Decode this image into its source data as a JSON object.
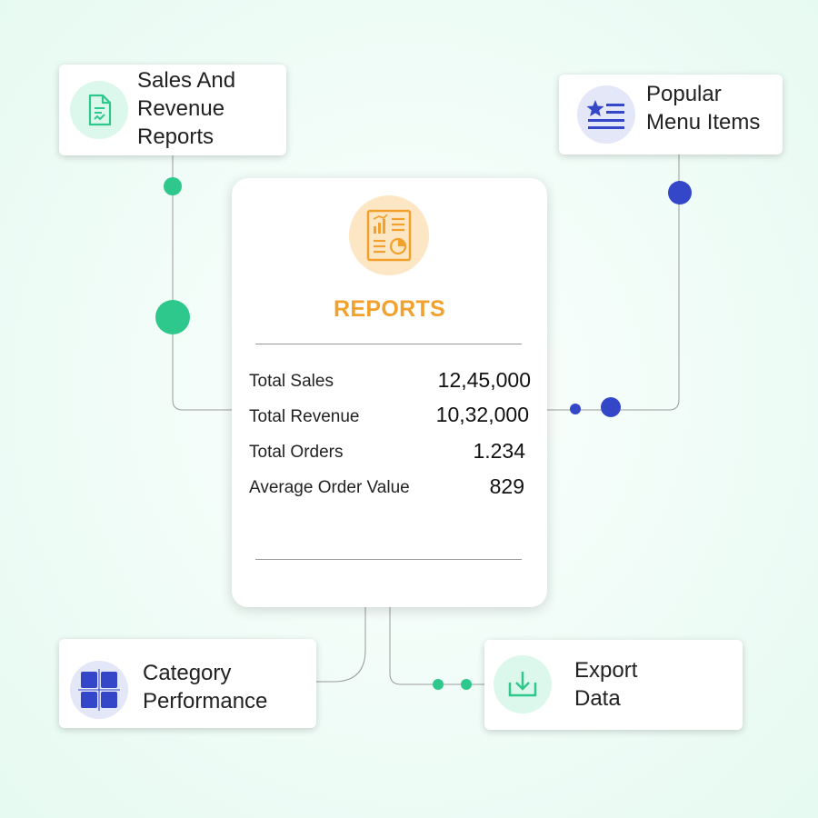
{
  "main": {
    "title": "REPORTS",
    "icon": "report-chart-icon",
    "metrics": [
      {
        "label": "Total Sales",
        "value": "12,45,000"
      },
      {
        "label": "Total Revenue",
        "value": "10,32,000"
      },
      {
        "label": "Total Orders",
        "value": "1.234"
      },
      {
        "label": "Average Order Value",
        "value": "829"
      }
    ]
  },
  "nodes": {
    "sales": {
      "label": "Sales And\nRevenue\nReports",
      "icon": "document-check-icon"
    },
    "popular": {
      "label": "Popular\nMenu Items",
      "icon": "star-list-icon"
    },
    "category": {
      "label": "Category\nPerformance",
      "icon": "grid-icon"
    },
    "export": {
      "label": "Export\nData",
      "icon": "download-icon"
    }
  },
  "colors": {
    "accent_orange": "#f2a12c",
    "green": "#2ec88c",
    "blue": "#3347c8",
    "orange_bg": "#fde6c4",
    "green_bg": "#dcf8ec",
    "blue_bg": "#e3e7f8"
  }
}
